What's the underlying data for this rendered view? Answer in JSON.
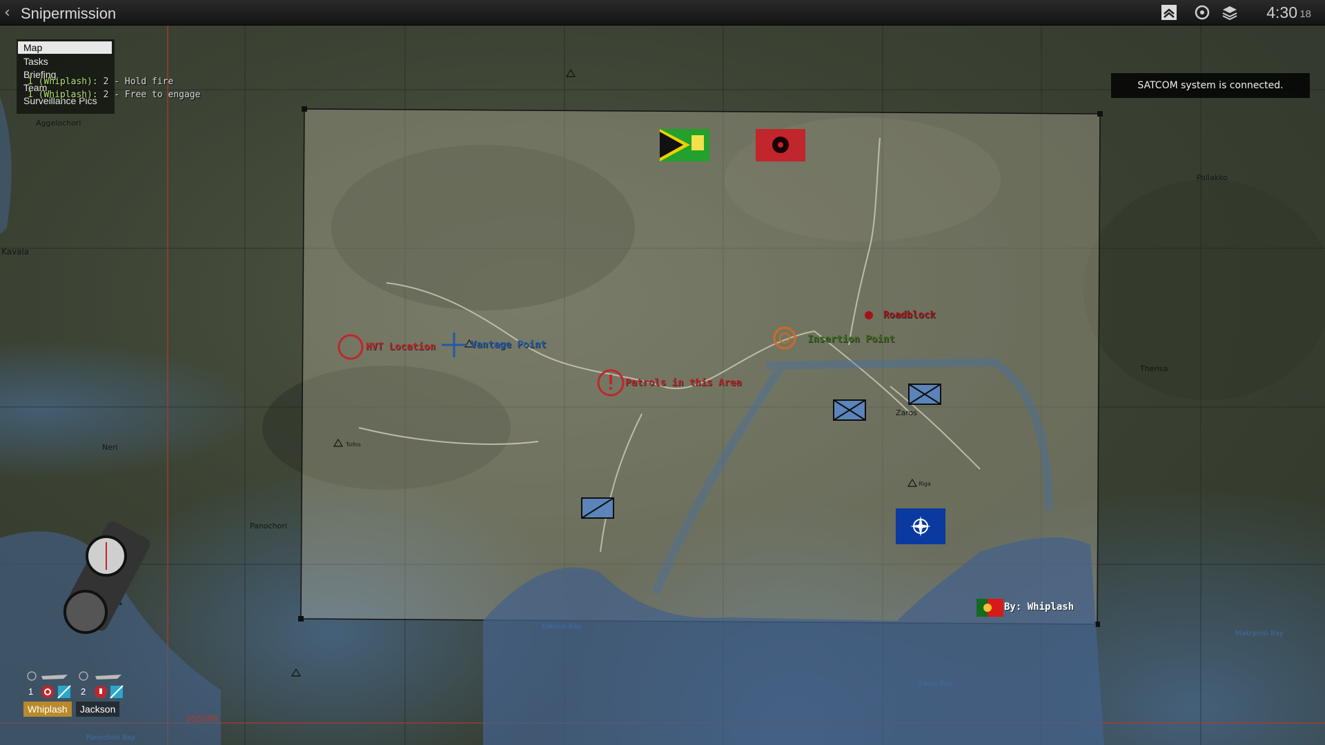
{
  "header": {
    "title": "Snipermission",
    "time": "4:30",
    "seconds": "18"
  },
  "menu": {
    "items": [
      {
        "label": "Map"
      },
      {
        "label": "Tasks"
      },
      {
        "label": "Briefing"
      },
      {
        "label": "Team"
      },
      {
        "label": "Surveillance Pics"
      }
    ]
  },
  "chat": [
    {
      "sender": "1 (Whiplash):",
      "message": " 2 - Hold fire"
    },
    {
      "sender": "1 (Whiplash):",
      "message": " 2 - Free to engage"
    }
  ],
  "notification": "SATCOM system is connected.",
  "markers": {
    "hvt": "HVT Location",
    "vantage": "Vantage Point",
    "patrols": "Patrols in this Area",
    "roadblock": "Roadblock",
    "insertion": "Insertion Point",
    "author": "By: Whiplash"
  },
  "places": {
    "kavala": "Kavala",
    "agios": "Aggelochori",
    "neri": "Neri",
    "panochori": "Panochori",
    "zaros": "Zaros",
    "therisa": "Therisa",
    "poliakko": "Poliakko",
    "edessa_bay": "Edessa Bay",
    "zaros_bay": "Zaros Bay",
    "panochori_bay": "Panochori Bay",
    "makrynisi_bay": "Makrynisi Bay",
    "tsifos": "Tsifos",
    "riga": "Riga"
  },
  "grid_ref": "055099",
  "units": [
    {
      "number": "1",
      "name": "Whiplash"
    },
    {
      "number": "2",
      "name": "Jackson"
    }
  ],
  "colors": {
    "marker_red": "#c0262b",
    "marker_blue": "#1f5aa8",
    "marker_green": "#3b6a1e",
    "nato_blue": "#0a3aa0",
    "selected_unit": "#b98a2a"
  },
  "icons": [
    "back-icon",
    "rank-icon",
    "gps-icon",
    "layers-icon",
    "compass-icon"
  ]
}
